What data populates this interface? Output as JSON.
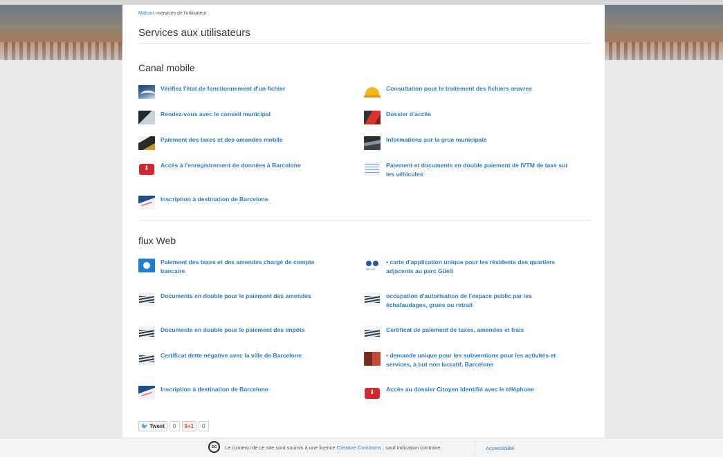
{
  "breadcrumb": {
    "home": "Maison",
    "separator": "«",
    "current": "services de l'utilisateur"
  },
  "page_title": "Services aux utilisateurs",
  "sections": {
    "mobile": {
      "title": "Canal mobile",
      "items": [
        {
          "label": "Vérifiez l'état de fonctionnement d'un fichier",
          "icon": "wave-icon"
        },
        {
          "label": "Consultation pour le traitement des fichiers œuvres",
          "icon": "helmet-icon"
        },
        {
          "label": "Rendez-vous avec le conseil municipal",
          "icon": "map-icon"
        },
        {
          "label": "Dossier d'accès",
          "icon": "access-icon"
        },
        {
          "label": "Paiement des taxes et des amendes mobile",
          "icon": "taxes-icon"
        },
        {
          "label": "Informations sur la grue municipale",
          "icon": "crane-icon"
        },
        {
          "label": "Accès à l'enregistrement de données à Barcelone",
          "icon": "red-bag-icon"
        },
        {
          "label": "Paiement et documents en double paiement de IVTM de taxe sur les véhicules",
          "icon": "documents-icon"
        },
        {
          "label": "Inscription à destination de Barcelone",
          "icon": "signature-icon"
        }
      ]
    },
    "web": {
      "title": "flux Web",
      "items": [
        {
          "label": "Paiement des taxes et des amendes chargé de compte bancaire",
          "icon": "drop-icon"
        },
        {
          "label": "• carte d'application unique pour les résidents des quartiers adjacents au parc Güell",
          "icon": "parc-guell-icon"
        },
        {
          "label": "Documents en double pour le paiement des amendes",
          "icon": "stack-icon"
        },
        {
          "label": "occupation d'autorisation de l'espace public par les échafaudages, grues ou retrait",
          "icon": "stack-icon"
        },
        {
          "label": "Documents en double pour le paiement des impôts",
          "icon": "stack-icon"
        },
        {
          "label": "Certificat de paiement de taxes, amendes et frais",
          "icon": "stack-icon"
        },
        {
          "label": "Certificat dette négative avec la ville de Barcelone",
          "icon": "stack-icon"
        },
        {
          "label": "• demande unique pour les subventions pour les activités et services, à but non lucratif, Barcelone",
          "icon": "people-icon"
        },
        {
          "label": "Inscription à destination de Barcelone",
          "icon": "signature-icon"
        },
        {
          "label": "Accès au dossier Citoyen identifié avec le téléphone",
          "icon": "red-bag-icon"
        }
      ]
    }
  },
  "social": {
    "tweet_label": "Tweet",
    "tweet_count": "0",
    "gplus_label": "8+1",
    "gplus_count": "0"
  },
  "footer": {
    "cc_symbol": "cc",
    "text_before": "Le contenu de ce site sont soumis à une licence",
    "link": "Creative Commons",
    "text_after": ", sauf indication contraire.",
    "accessibility": "Accessibilité"
  },
  "colors": {
    "link": "#2a7cc6",
    "title": "#333333",
    "background": "#eaeaea"
  }
}
